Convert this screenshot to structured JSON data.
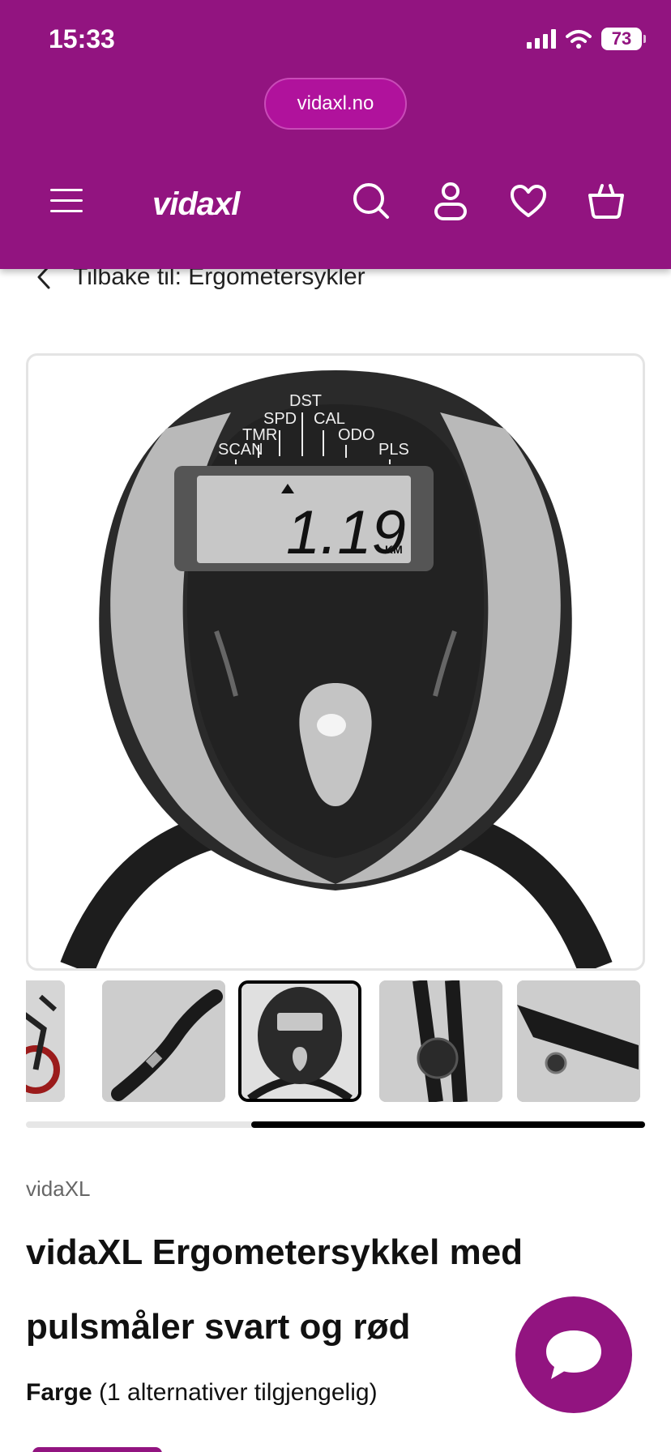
{
  "status_bar": {
    "time": "15:33",
    "battery": "73"
  },
  "browser": {
    "url": "vidaxl.no"
  },
  "header": {
    "logo_text": "vidaxl"
  },
  "breadcrumb": {
    "back_label": "Tilbake til: Ergometersykler"
  },
  "product_image": {
    "display_labels": [
      "DST",
      "SPD",
      "CAL",
      "TMR",
      "ODO",
      "SCAN",
      "PLS"
    ],
    "display_reading": "1.19",
    "display_unit": "KM"
  },
  "gallery": {
    "thumbnail_count": 5,
    "selected_index": 2
  },
  "product": {
    "brand": "vidaXL",
    "title": "vidaXL Ergometersykkel med pulsmåler svart og rød",
    "color_label": "Farge",
    "color_alternatives": "(1 alternativer tilgjengelig)"
  },
  "colors": {
    "brand_purple": "#921480",
    "url_pill": "#b0129c"
  },
  "icons": [
    "menu-icon",
    "search-icon",
    "account-icon",
    "heart-icon",
    "cart-icon",
    "back-chevron-icon",
    "chat-icon"
  ]
}
